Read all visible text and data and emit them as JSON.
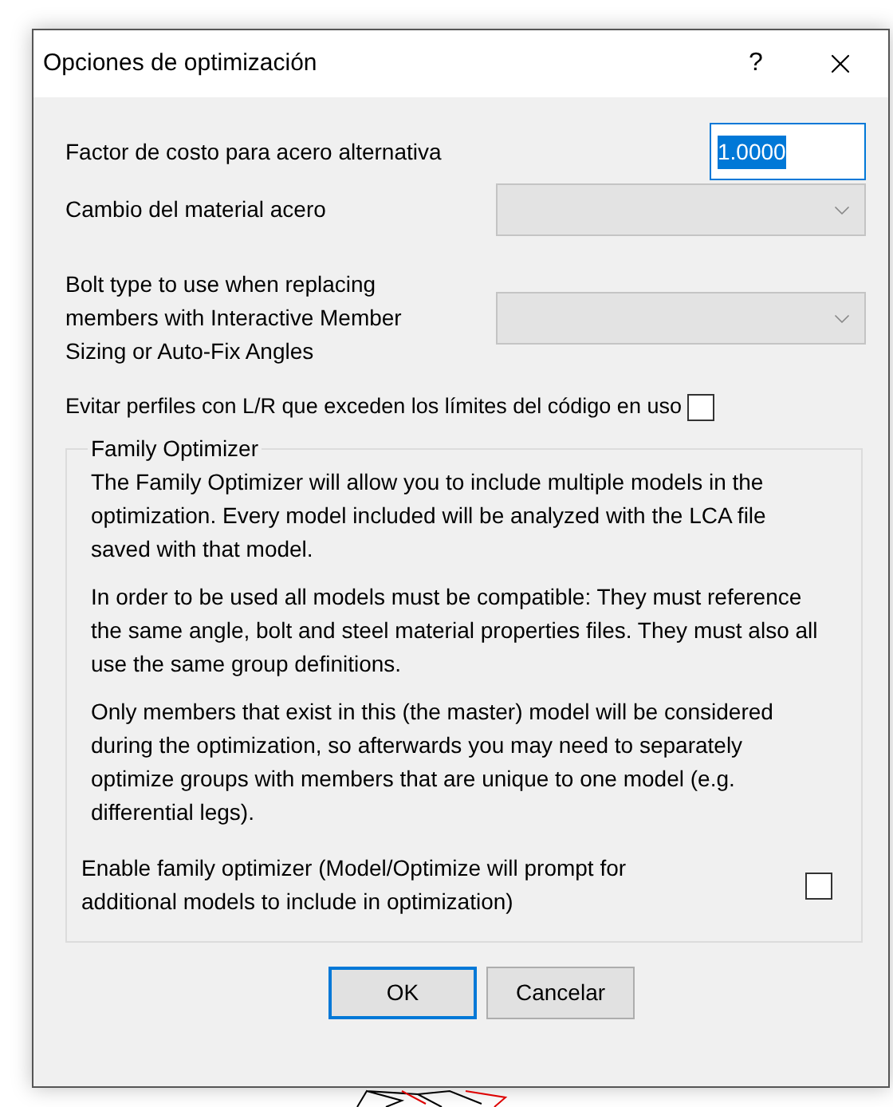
{
  "window": {
    "title": "Opciones de optimización",
    "help": "?"
  },
  "fields": [
    {
      "kind": "text",
      "label": "Factor de costo para acero alternativa",
      "value": "1.0000",
      "text_selected": true
    },
    {
      "kind": "dropdown",
      "label": "Cambio del material acero",
      "disabled": true
    },
    {
      "kind": "dropdown",
      "label": "Bolt type to use when replacing members with Interactive Member Sizing or Auto-Fix Angles",
      "disabled": true
    }
  ],
  "avoid_option": {
    "label": "Evitar perfiles con L/R que exceden los límites del código en uso",
    "checked": false
  },
  "family_optimizer": {
    "title": "Family Optimizer",
    "paragraphs": [
      "The Family Optimizer will allow you to include multiple models in the optimization.  Every model included will be analyzed with the LCA file saved with that model.",
      "In order to be used all models must be compatible: They must reference the same angle, bolt and steel material properties files.  They must also all use the same group definitions.",
      "Only members that exist in this (the master) model will be considered during the optimization, so afterwards you may need to separately optimize groups with members that are unique to one model (e.g. differential legs)."
    ],
    "enable": {
      "label": "Enable family optimizer (Model/Optimize will prompt for additional models to include in optimization)",
      "checked": false
    }
  },
  "buttons": [
    {
      "label": "OK",
      "default": true
    },
    {
      "label": "Cancelar",
      "default": false
    }
  ]
}
